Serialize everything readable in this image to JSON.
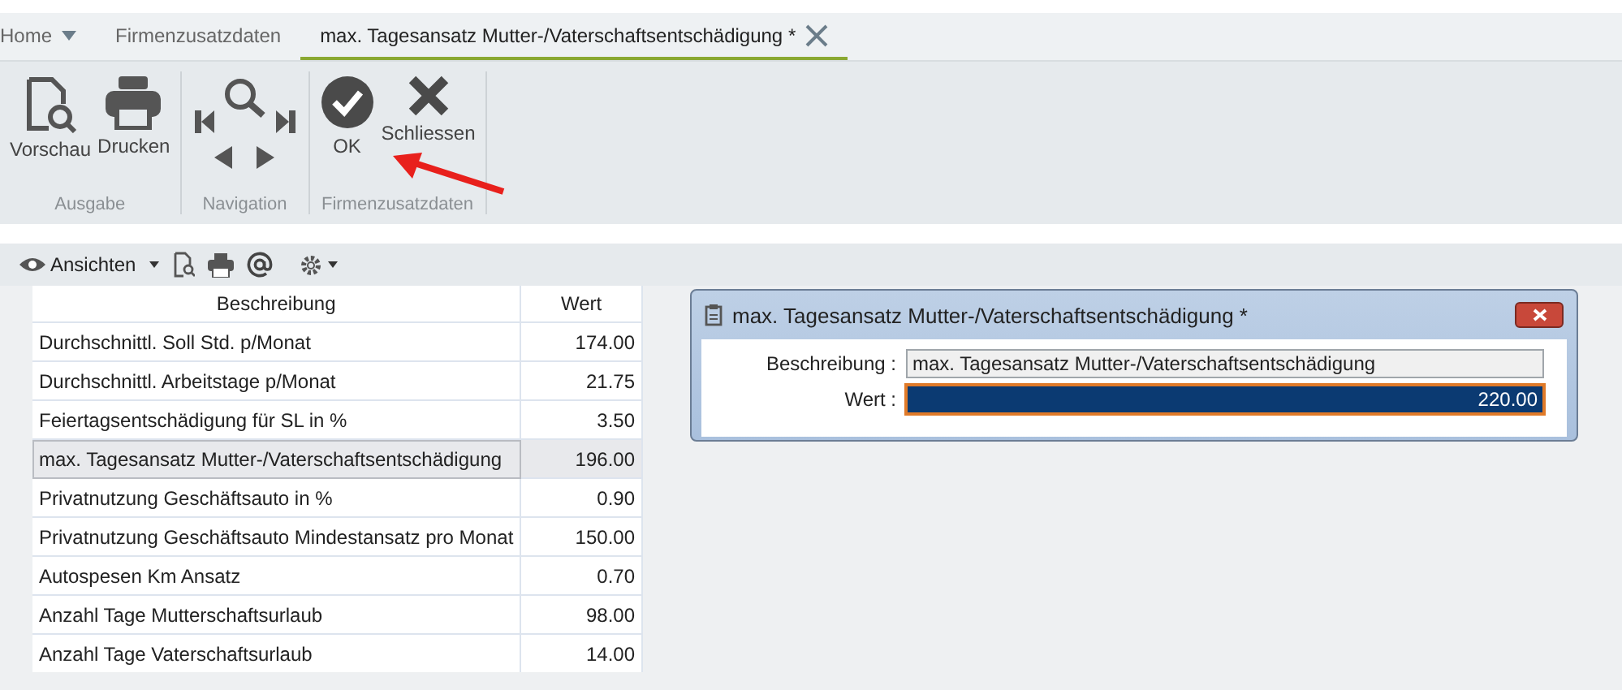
{
  "tabs": [
    {
      "label": "Home",
      "kind": "menu",
      "selected": false
    },
    {
      "label": "Firmenzusatzdaten",
      "kind": "plain",
      "selected": false
    },
    {
      "label": "max. Tagesansatz Mutter-/Vaterschaftsentschädigung *",
      "kind": "closable",
      "selected": true
    }
  ],
  "ribbon": {
    "groups": [
      {
        "label": "Ausgabe",
        "buttons": [
          {
            "label": "Vorschau",
            "kind": "preview"
          },
          {
            "label": "Drucken",
            "kind": "print"
          }
        ]
      },
      {
        "label": "Navigation",
        "buttons": [
          {
            "kind": "nav"
          }
        ]
      },
      {
        "label": "Firmenzusatzdaten",
        "buttons": [
          {
            "label": "OK",
            "kind": "ok"
          },
          {
            "label": "Schliessen",
            "kind": "close"
          }
        ]
      }
    ]
  },
  "toolbar": {
    "views_label": "Ansichten"
  },
  "table": {
    "columns": [
      "Beschreibung",
      "Wert"
    ],
    "rows": [
      {
        "cells": [
          "Durchschnittl. Soll Std. p/Monat",
          "174.00"
        ],
        "selected": false
      },
      {
        "cells": [
          "Durchschnittl. Arbeitstage p/Monat",
          "21.75"
        ],
        "selected": false
      },
      {
        "cells": [
          "Feiertagsentschädigung für SL in %",
          "3.50"
        ],
        "selected": false
      },
      {
        "cells": [
          "max. Tagesansatz Mutter-/Vaterschaftsentschädigung",
          "196.00"
        ],
        "selected": true
      },
      {
        "cells": [
          "Privatnutzung Geschäftsauto in %",
          "0.90"
        ],
        "selected": false
      },
      {
        "cells": [
          "Privatnutzung Geschäftsauto Mindestansatz pro Monat",
          "150.00"
        ],
        "selected": false
      },
      {
        "cells": [
          "Autospesen Km Ansatz",
          "0.70"
        ],
        "selected": false
      },
      {
        "cells": [
          "Anzahl Tage Mutterschaftsurlaub",
          "98.00"
        ],
        "selected": false
      },
      {
        "cells": [
          "Anzahl Tage Vaterschaftsurlaub",
          "14.00"
        ],
        "selected": false
      }
    ]
  },
  "dialog": {
    "title": "max. Tagesansatz Mutter-/Vaterschaftsentschädigung *",
    "fields": [
      {
        "label": "Beschreibung :",
        "value": "max. Tagesansatz Mutter-/Vaterschaftsentschädigung",
        "kind": "readonly"
      },
      {
        "label": "Wert :",
        "value": "220.00",
        "kind": "selected"
      }
    ]
  }
}
